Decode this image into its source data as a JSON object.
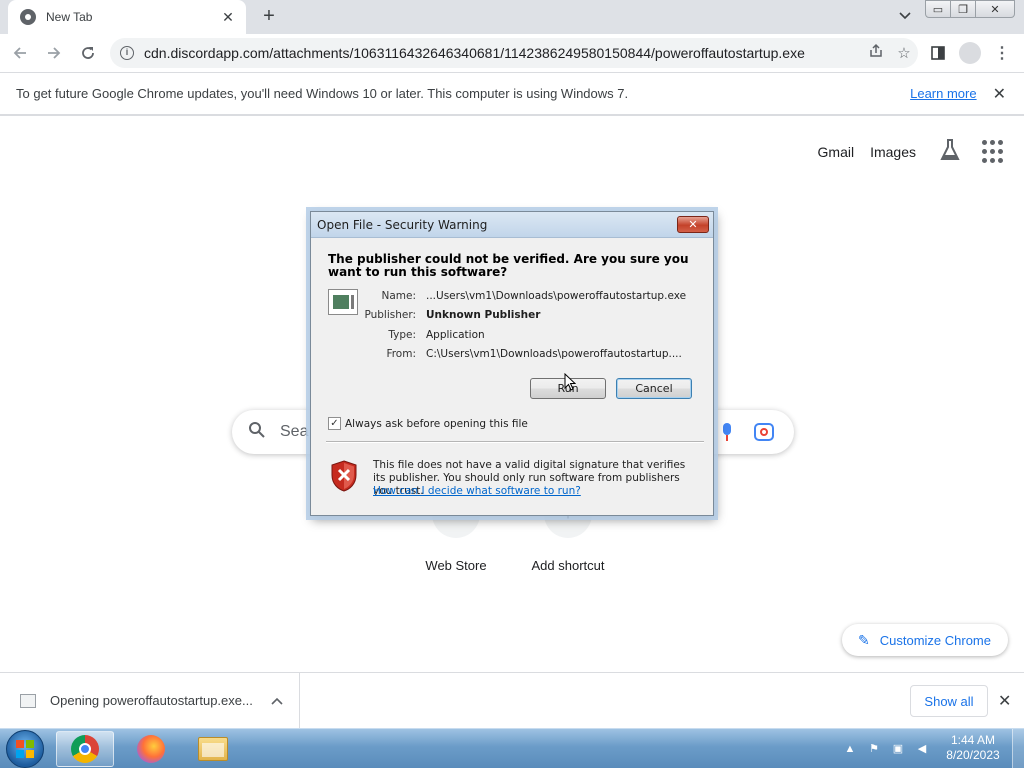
{
  "browser": {
    "tab_title": "New Tab",
    "tab_close": "✕",
    "new_tab": "+",
    "url": "cdn.discordapp.com/attachments/1063116432646340681/1142386249580150844/poweroffautostartup.exe",
    "window_controls": {
      "minimize": "▭",
      "restore": "❐",
      "close": "✕"
    }
  },
  "infobar": {
    "message": "To get future Google Chrome updates, you'll need Windows 10 or later. This computer is using Windows 7.",
    "learn_more": "Learn more",
    "close": "✕"
  },
  "ntp": {
    "gmail": "Gmail",
    "images": "Images",
    "search_placeholder": "Sea",
    "shortcuts": [
      {
        "label": "Web Store"
      },
      {
        "label": "Add shortcut"
      }
    ],
    "customize_label": "Customize Chrome"
  },
  "dialog": {
    "title": "Open File - Security Warning",
    "close": "✕",
    "question": "The publisher could not be verified.  Are you sure you want to run this software?",
    "fields": [
      {
        "label": "Name:",
        "value": "...Users\\vm1\\Downloads\\poweroffautostartup.exe"
      },
      {
        "label": "Publisher:",
        "value": "Unknown Publisher"
      },
      {
        "label": "Type:",
        "value": "Application"
      },
      {
        "label": "From:",
        "value": "C:\\Users\\vm1\\Downloads\\poweroffautostartup...."
      }
    ],
    "run_button": "Run",
    "cancel_button": "Cancel",
    "checkbox_label": "Always ask before opening this file",
    "checkbox_checked": true,
    "warning_text": "This file does not have a valid digital signature that verifies its publisher.  You should only run software from publishers you trust.",
    "help_link": "How can I decide what software to run?"
  },
  "download_shelf": {
    "item_text": "Opening poweroffautostartup.exe...",
    "show_all": "Show all",
    "close": "✕"
  },
  "taskbar": {
    "time": "1:44 AM",
    "date": "8/20/2023"
  },
  "icons": {
    "tab_search": "chevron-down-icon",
    "share": "share-icon",
    "bookmark": "star-icon",
    "side_panel": "side-panel-icon",
    "profile": "profile-icon",
    "menu": "menu-icon"
  }
}
